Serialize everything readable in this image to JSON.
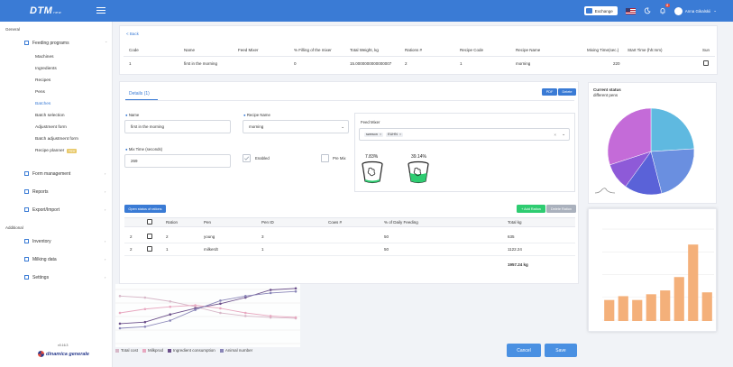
{
  "header": {
    "logo": "DTM",
    "logo_suffix": "new",
    "exchange_label": "Exchange",
    "notification_count": "8",
    "user_name": "Anna Gikalskii"
  },
  "sidebar": {
    "section_general": "General",
    "feeding_programs": "Feeding programs",
    "sub_items": [
      "Machines",
      "Ingredients",
      "Recipes",
      "Pens",
      "Batches",
      "Batch selection",
      "Adjustment form",
      "Batch adjustment form",
      "Recipe planner"
    ],
    "new_badge": "New",
    "form_management": "Form management",
    "reports": "Reports",
    "export_import": "Export/Import",
    "section_additional": "Additional",
    "inventory": "Inventory",
    "milking_data": "Milking data",
    "settings": "Settings",
    "version": "v0.16.3",
    "brand": "dinamica generale"
  },
  "summary": {
    "back_label": "< Back",
    "columns": [
      "Code",
      "Name",
      "Feed Mixer",
      "% Filling of the mixer",
      "Total Weight, kg",
      "Rations #",
      "Recipe Code",
      "Recipe Name",
      "Mixing Time(sec.)",
      "Start Time (hh:mm)",
      "Sun"
    ],
    "row": [
      "1",
      "first in the morning",
      "",
      "0",
      "15.0000000000000007",
      "2",
      "1",
      "morning",
      "220",
      "",
      ""
    ]
  },
  "details": {
    "tab_label": "Details",
    "tab_count": "(1)",
    "pdf_label": "PDF",
    "delete_label": "Delete",
    "name_label": "Name",
    "name_value": "first in the morning",
    "recipe_label": "Recipe Name",
    "recipe_value": "morning",
    "mix_time_label": "Mix Time (seconds)",
    "mix_time_value": "269",
    "enabled_label": "Enabled",
    "premix_label": "Pre Mix",
    "feed_mixer_label": "Feed Mixer",
    "feed_mixer_tags": [
      "sweson",
      "EUHN"
    ],
    "fill_pct_1": "7.83%",
    "fill_pct_2": "39.14%",
    "open_rations_label": "Open status of rations",
    "add_ration_label": "+ Add Ration",
    "delete_ration_label": "Delete Ration",
    "ration_columns": [
      "",
      "Ration",
      "Pen",
      "Pen ID",
      "Cows #",
      "% of Daily Feeding",
      "Total kg"
    ],
    "rations": [
      [
        "2",
        "",
        "2",
        "young",
        "3",
        "",
        "50",
        "635"
      ],
      [
        "2",
        "",
        "1",
        "milkerdt",
        "1",
        "",
        "50",
        "1122.24"
      ]
    ],
    "total": "1957.24 kg"
  },
  "overlay_line_legend": [
    "Total cost",
    "Milkprod",
    "Ingredient consumption",
    "Animal number"
  ],
  "overlay_line_colors": [
    "#d7b8c8",
    "#e8a8c0",
    "#6b4f8a",
    "#8a86b8"
  ],
  "pie_card": {
    "title": "Current status",
    "subtitle": "different pens"
  },
  "buttons": {
    "cancel": "Cancel",
    "save": "Save"
  },
  "colors": {
    "primary": "#3a7bd5",
    "green": "#2ecc71",
    "bar": "#f4b07a"
  },
  "chart_data": [
    {
      "type": "pie",
      "title": "Current status",
      "subtitle": "different pens",
      "values": [
        24,
        22,
        14,
        10,
        30
      ],
      "colors": [
        "#5fb9e0",
        "#6a8fe0",
        "#5a62d8",
        "#8e5ad8",
        "#c46bd8"
      ]
    },
    {
      "type": "bar",
      "values": [
        22,
        26,
        22,
        28,
        32,
        46,
        80,
        30
      ],
      "ylim": [
        0,
        100
      ]
    },
    {
      "type": "line",
      "series": [
        {
          "name": "Total cost",
          "values": [
            62,
            60,
            55,
            48,
            40,
            36,
            34,
            33
          ]
        },
        {
          "name": "Milkprod",
          "values": [
            40,
            45,
            48,
            50,
            46,
            40,
            36,
            34
          ]
        },
        {
          "name": "Ingredient consumption",
          "values": [
            26,
            28,
            38,
            46,
            52,
            60,
            70,
            72
          ]
        },
        {
          "name": "Animal number",
          "values": [
            20,
            22,
            30,
            44,
            56,
            62,
            66,
            68
          ]
        }
      ]
    }
  ]
}
